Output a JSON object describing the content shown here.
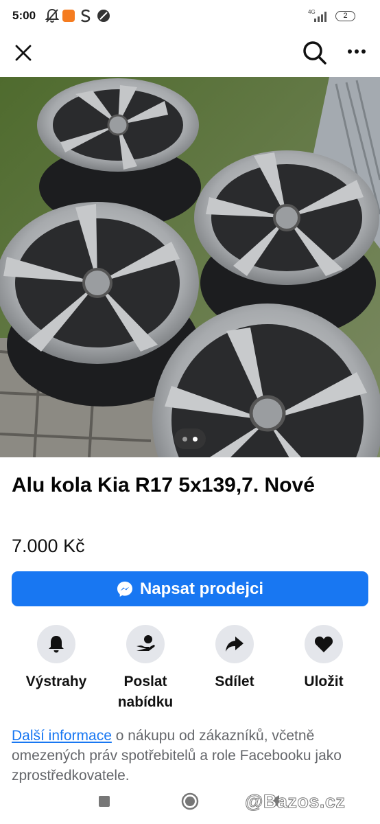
{
  "status_bar": {
    "time": "5:00",
    "network": "4G",
    "battery": "2",
    "icons": [
      "bell-off-icon",
      "temu-app-icon",
      "s-app-icon",
      "slash-circle-icon",
      "signal-icon",
      "battery-icon"
    ]
  },
  "top_bar": {
    "icons": [
      "close-icon",
      "search-icon",
      "more-icon"
    ]
  },
  "photo": {
    "pager_total": 2,
    "pager_active": 2
  },
  "listing": {
    "title": "Alu kola Kia R17 5x139,7. Nové",
    "price": "7.000 Kč"
  },
  "message_button": {
    "label": "Napsat prodejci",
    "color": "#1877f2"
  },
  "actions": [
    {
      "label": "Výstrahy",
      "icon": "bell-icon"
    },
    {
      "label": "Poslat nabídku",
      "icon": "offer-icon"
    },
    {
      "label": "Sdílet",
      "icon": "share-icon"
    },
    {
      "label": "Uložit",
      "icon": "heart-icon"
    }
  ],
  "info": {
    "link_text": "Další informace",
    "text": " o nákupu od zákazníků, včetně omezených práv spotřebitelů a role Facebooku jako zprostředkovatele."
  },
  "nav_bar": {
    "icons": [
      "recents-icon",
      "home-icon",
      "back-icon"
    ]
  },
  "watermark": "@Bazos.cz"
}
